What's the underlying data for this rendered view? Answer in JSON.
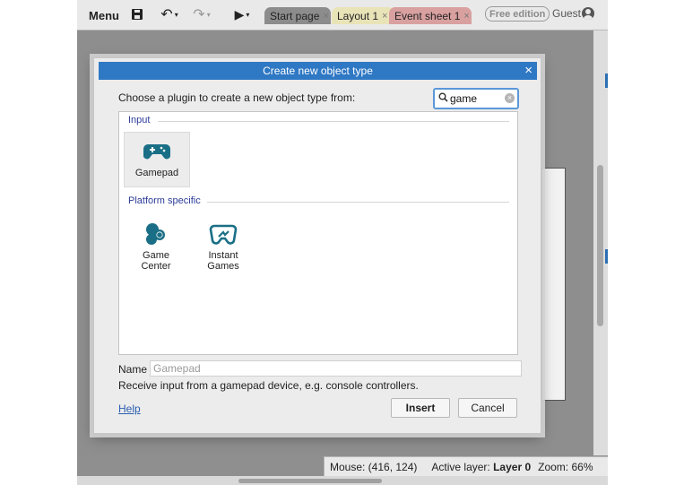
{
  "toolbar": {
    "menu_label": "Menu",
    "undo_glyph": "↶",
    "redo_glyph": "↷",
    "play_glyph": "▶",
    "caret_glyph": "▾",
    "tabs": [
      {
        "label": "Start page",
        "close": "×"
      },
      {
        "label": "Layout 1",
        "close": "×"
      },
      {
        "label": "Event sheet 1",
        "close": "×"
      }
    ],
    "edition_badge": "Free edition",
    "user_label": "Guest",
    "icons": [
      "menu",
      "save-icon",
      "undo-icon",
      "redo-icon",
      "play-icon",
      "user-icon"
    ]
  },
  "statusbar": {
    "mouse": "Mouse: (416, 124)",
    "active_layer_label": "Active layer:",
    "active_layer_value": "Layer 0",
    "zoom": "Zoom: 66%"
  },
  "dialog": {
    "title": "Create new object type",
    "close_glyph": "×",
    "prompt": "Choose a plugin to create a new object type from:",
    "search": {
      "value": "game",
      "clear_glyph": "×"
    },
    "categories": [
      {
        "label": "Input",
        "plugins": [
          {
            "name": "Gamepad",
            "line2": "",
            "icon": "gamepad-icon",
            "selected": true
          }
        ]
      },
      {
        "label": "Platform specific",
        "plugins": [
          {
            "name": "Game",
            "line2": "Center",
            "icon": "game-center-icon",
            "selected": false
          },
          {
            "name": "Instant",
            "line2": "Games",
            "icon": "instant-games-icon",
            "selected": false
          }
        ]
      }
    ],
    "name_label": "Name",
    "name_value": "Gamepad",
    "description": "Receive input from a gamepad device, e.g. console controllers.",
    "help_label": "Help",
    "insert_label": "Insert",
    "cancel_label": "Cancel"
  },
  "colors": {
    "titlebar": "#2f78c4",
    "icon_teal": "#1a6f86",
    "category_text": "#2c3c9a",
    "link": "#2a5db0"
  }
}
